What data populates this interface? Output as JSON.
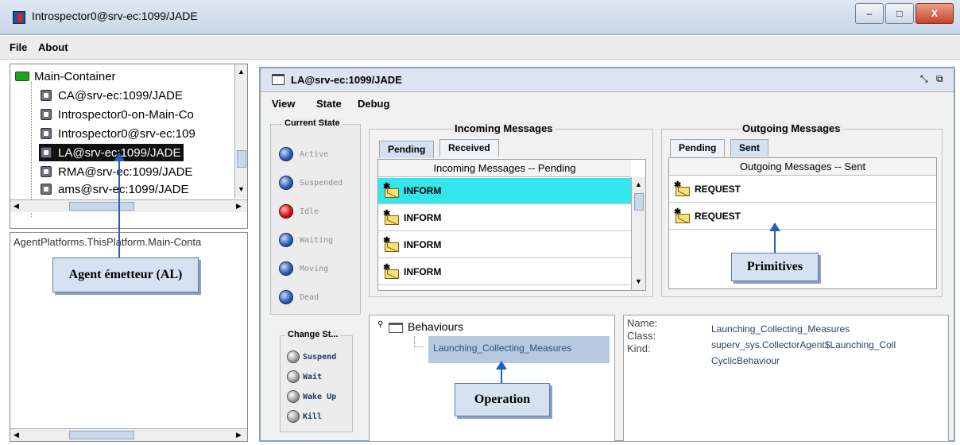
{
  "window": {
    "title": "Introspector0@srv-ec:1099/JADE",
    "minimize": "–",
    "maximize": "□",
    "close": "X"
  },
  "menu": {
    "file": "File",
    "about": "About"
  },
  "tree": {
    "root": "Main-Container",
    "items": [
      "CA@srv-ec:1099/JADE",
      "Introspector0-on-Main-Co",
      "Introspector0@srv-ec:109",
      "LA@srv-ec:1099/JADE",
      "RMA@srv-ec:1099/JADE",
      "ams@srv-ec:1099/JADE"
    ],
    "selected_index": 3
  },
  "platform_path": "AgentPlatforms.ThisPlatform.Main-Conta",
  "callouts": {
    "agent": "Agent émetteur (AL)",
    "primitives": "Primitives",
    "operation": "Operation"
  },
  "inner": {
    "title": "LA@srv-ec:1099/JADE",
    "menu": {
      "view": "View",
      "state": "State",
      "debug": "Debug"
    }
  },
  "current_state": {
    "title": "Current State",
    "states": [
      {
        "label": "Active",
        "color": "blue"
      },
      {
        "label": "Suspended",
        "color": "blue"
      },
      {
        "label": "Idle",
        "color": "red"
      },
      {
        "label": "Waiting",
        "color": "blue"
      },
      {
        "label": "Moving",
        "color": "blue"
      },
      {
        "label": "Dead",
        "color": "blue"
      }
    ]
  },
  "change_state": {
    "title": "Change St...",
    "buttons": [
      "Suspend",
      "Wait",
      "Wake Up",
      "Kill"
    ]
  },
  "incoming": {
    "title": "Incoming Messages",
    "tabs": [
      "Pending",
      "Received"
    ],
    "selected_tab": "Pending",
    "table_header": "Incoming Messages -- Pending",
    "rows": [
      "INFORM",
      "INFORM",
      "INFORM",
      "INFORM"
    ],
    "highlight_color": "#33e6ee"
  },
  "outgoing": {
    "title": "Outgoing Messages",
    "tabs": [
      "Pending",
      "Sent"
    ],
    "selected_tab": "Sent",
    "table_header": "Outgoing Messages -- Sent",
    "rows": [
      "REQUEST",
      "REQUEST"
    ]
  },
  "behaviours": {
    "root": "Behaviours",
    "item": "Launching_Collecting_Measures"
  },
  "details": {
    "name_label": "Name:",
    "class_label": "Class:",
    "kind_label": "Kind:",
    "name_value": "Launching_Collecting_Measures",
    "class_value": "superv_sys.CollectorAgent$Launching_Coll",
    "kind_value": "CyclicBehaviour"
  }
}
